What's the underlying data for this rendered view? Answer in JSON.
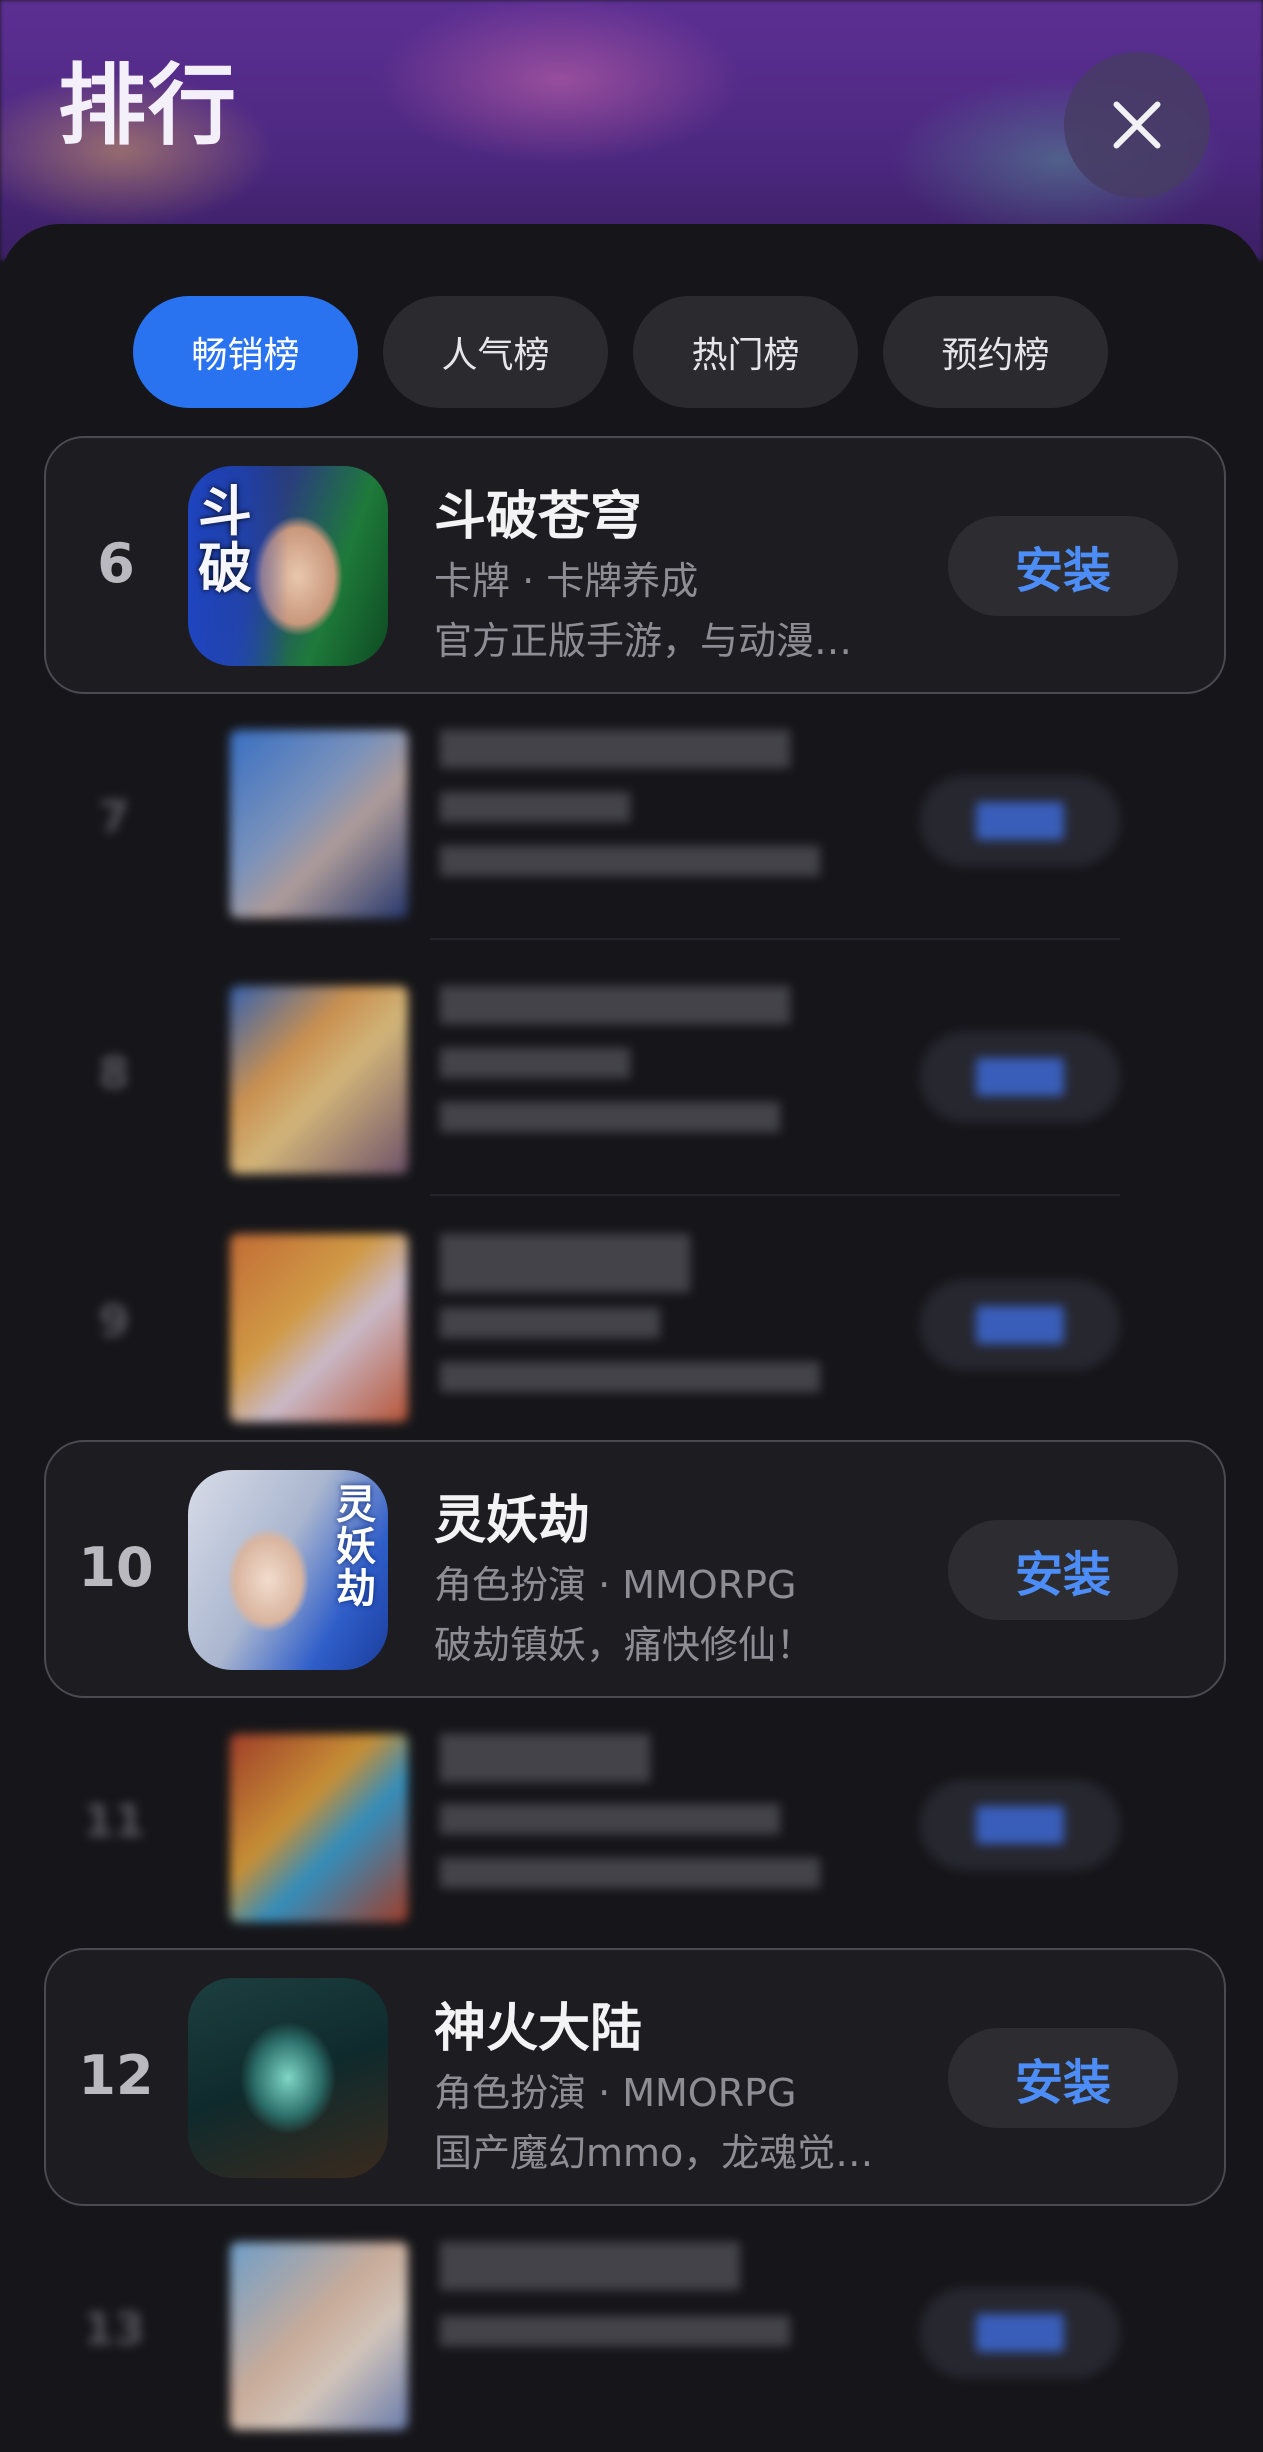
{
  "header": {
    "title": "排行"
  },
  "tabs": [
    "畅销榜",
    "人气榜",
    "热门榜",
    "预约榜"
  ],
  "active_tab": "畅销榜",
  "apps": [
    {
      "rank": "6",
      "name": "斗破苍穹",
      "tags": "卡牌 · 卡牌养成",
      "desc": "官方正版手游，与动漫…",
      "button": "安装",
      "icon_text": "斗破"
    },
    {
      "rank": "10",
      "name": "灵妖劫",
      "tags": "角色扮演 · MMORPG",
      "desc": "破劫镇妖，痛快修仙！",
      "button": "安装",
      "icon_text": "灵妖劫"
    },
    {
      "rank": "12",
      "name": "神火大陆",
      "tags": "角色扮演 · MMORPG",
      "desc": "国产魔幻mmo，龙魂觉…",
      "button": "安装"
    }
  ],
  "blurred_ranks": [
    "7",
    "8",
    "9",
    "11",
    "13"
  ],
  "colors": {
    "accent": "#2a73f0",
    "install_text": "#4d8df7",
    "background": "#16161a"
  }
}
